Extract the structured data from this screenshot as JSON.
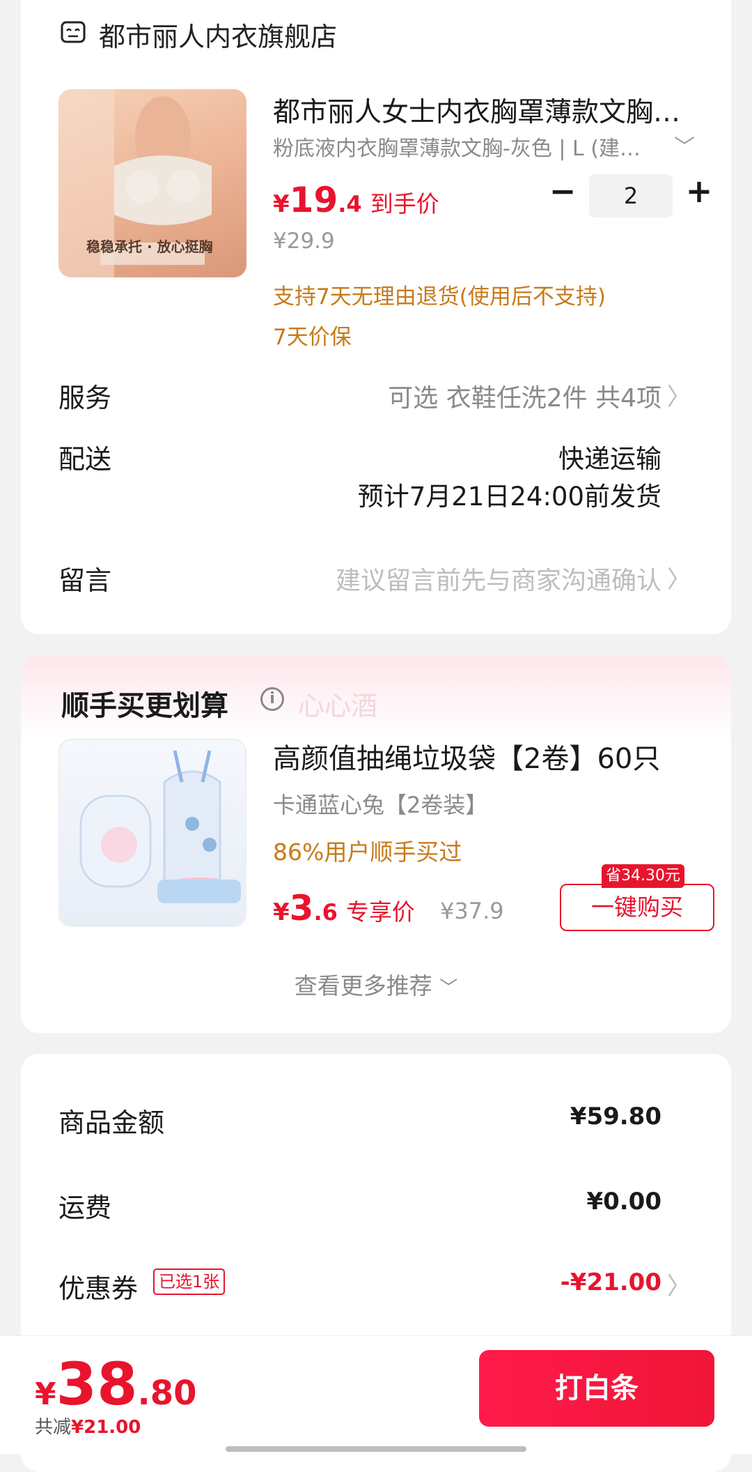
{
  "store": {
    "name": "都市丽人内衣旗舰店",
    "icon": "store-icon"
  },
  "product": {
    "title": "都市丽人女士内衣胸罩薄款文胸…",
    "sku": "粉底液内衣胸罩薄款文胸-灰色 | L (建…",
    "thumb_caption": "稳稳承托 · 放心挺胸",
    "price_symbol": "¥",
    "price_int": "19",
    "price_dec": ".4",
    "price_label": "到手价",
    "original_price": "¥29.9",
    "quantity": "2",
    "promo_return": "支持7天无理由退货(使用后不支持)",
    "promo_price_protect": "7天价保"
  },
  "service": {
    "label": "服务",
    "value": "可选 衣鞋任洗2件 共4项"
  },
  "delivery": {
    "label": "配送",
    "method": "快递运输",
    "estimate": "预计7月21日24:00前发货"
  },
  "message": {
    "label": "留言",
    "placeholder": "建议留言前先与商家沟通确认"
  },
  "bundle": {
    "title": "顺手买更划算",
    "faint_text": "心心酒",
    "item_title": "高颜值抽绳垃圾袋【2卷】60只",
    "variant": "卡通蓝心兔【2卷装】",
    "promo": "86%用户顺手买过",
    "price_symbol": "¥",
    "price_int": "3",
    "price_dec": ".6",
    "price_label": "专享价",
    "original_price": "¥37.9",
    "save_badge": "省34.30元",
    "buy_label": "一键购买",
    "more_label": "查看更多推荐"
  },
  "totals": {
    "goods_label": "商品金额",
    "goods_value": "¥59.80",
    "shipping_label": "运费",
    "shipping_value": "¥0.00",
    "coupon_label": "优惠券",
    "coupon_badge": "已选1张",
    "coupon_value": "-¥21.00"
  },
  "bottom": {
    "price_symbol": "¥",
    "price_int": "38",
    "price_dec": ".80",
    "reduce_label": "共减",
    "reduce_value": "¥21.00",
    "pay_label": "打白条"
  },
  "colors": {
    "accent_red": "#e8142d",
    "promo_orange": "#c77a1a"
  }
}
